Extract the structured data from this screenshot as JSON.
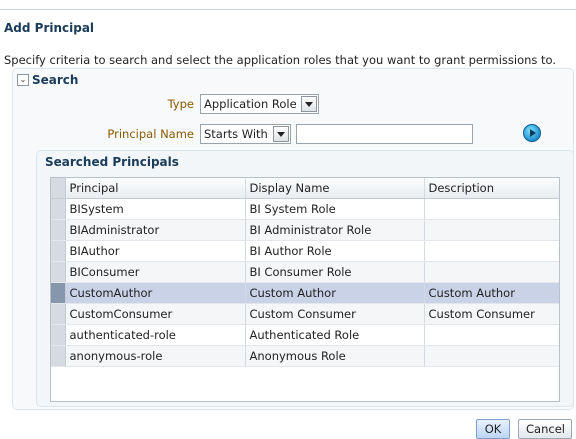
{
  "dialog": {
    "title": "Add Principal",
    "instructions": "Specify criteria to search and select the application roles that you want to grant permissions to."
  },
  "search": {
    "title": "Search",
    "collapse_glyph": "⌄",
    "type_label": "Type",
    "type_value": "Application Role",
    "principal_name_label": "Principal Name",
    "match_value": "Starts With",
    "principal_name_value": ""
  },
  "results": {
    "title": "Searched Principals",
    "columns": [
      "Principal",
      "Display Name",
      "Description"
    ],
    "rows": [
      {
        "principal": "BISystem",
        "display_name": "BI System Role",
        "description": ""
      },
      {
        "principal": "BIAdministrator",
        "display_name": "BI Administrator Role",
        "description": ""
      },
      {
        "principal": "BIAuthor",
        "display_name": "BI Author Role",
        "description": ""
      },
      {
        "principal": "BIConsumer",
        "display_name": "BI Consumer Role",
        "description": ""
      },
      {
        "principal": "CustomAuthor",
        "display_name": "Custom Author",
        "description": "Custom Author"
      },
      {
        "principal": "CustomConsumer",
        "display_name": "Custom Consumer",
        "description": "Custom Consumer"
      },
      {
        "principal": "authenticated-role",
        "display_name": "Authenticated Role",
        "description": ""
      },
      {
        "principal": "anonymous-role",
        "display_name": "Anonymous Role",
        "description": ""
      }
    ],
    "selected_row": 4
  },
  "footer": {
    "ok_label": "OK",
    "cancel_label": "Cancel"
  },
  "colors": {
    "title_text": "#1b3b5a",
    "label_text": "#8a5a00",
    "selected_row": "#c9d2e6"
  },
  "icons": {
    "collapse": "chevron-down-icon",
    "dropdown": "triangle-down-icon",
    "go": "go-arrow-icon"
  }
}
